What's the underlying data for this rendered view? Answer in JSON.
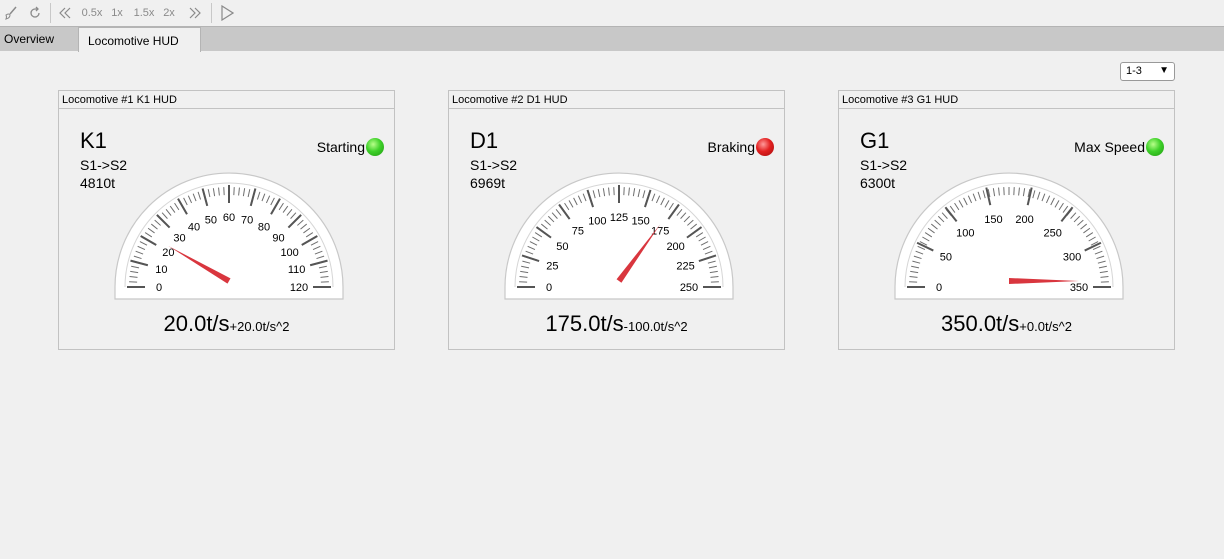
{
  "toolbar": {
    "buttons": [
      {
        "name": "brush-icon"
      },
      {
        "name": "rotate-icon"
      },
      {
        "name": "rewind-icon"
      },
      {
        "label": "0.5x"
      },
      {
        "label": "1x"
      },
      {
        "label": "1.5x"
      },
      {
        "label": "2x"
      },
      {
        "name": "fast-forward-icon"
      },
      {
        "name": "play-icon"
      }
    ],
    "labels": {
      "s05": "0.5x",
      "s1": "1x",
      "s15": "1.5x",
      "s2": "2x"
    }
  },
  "tabs": [
    {
      "label": "Overview",
      "active": false
    },
    {
      "label": "Locomotive HUD",
      "active": true
    }
  ],
  "range_selector": {
    "value": "1-3",
    "caret": "▼"
  },
  "panels": [
    {
      "header": "Locomotive #1 K1 HUD",
      "name": "K1",
      "route": "S1->S2",
      "weight": "4810t",
      "status": "Starting",
      "lamp": "green",
      "speed_text": "20.0t/s",
      "accel_text": "+20.0t/s^2",
      "gauge": {
        "min": 0,
        "max": 120,
        "value": 20,
        "tick_labels": [
          "0",
          "10",
          "20",
          "30",
          "40",
          "50",
          "60",
          "70",
          "80",
          "90",
          "100",
          "110",
          "120"
        ]
      }
    },
    {
      "header": "Locomotive #2 D1 HUD",
      "name": "D1",
      "route": "S1->S2",
      "weight": "6969t",
      "status": "Braking",
      "lamp": "red",
      "speed_text": "175.0t/s",
      "accel_text": "-100.0t/s^2",
      "gauge": {
        "min": 0,
        "max": 250,
        "value": 175,
        "tick_labels": [
          "0",
          "25",
          "50",
          "75",
          "100",
          "125",
          "150",
          "175",
          "200",
          "225",
          "250"
        ]
      }
    },
    {
      "header": "Locomotive #3 G1 HUD",
      "name": "G1",
      "route": "S1->S2",
      "weight": "6300t",
      "status": "Max Speed",
      "lamp": "green",
      "speed_text": "350.0t/s",
      "accel_text": "+0.0t/s^2",
      "gauge": {
        "min": 0,
        "max": 350,
        "value": 350,
        "tick_labels": [
          "0",
          "50",
          "100",
          "150",
          "200",
          "250",
          "300",
          "350"
        ]
      }
    }
  ],
  "colors": {
    "needle": "#d9363e",
    "lamp_green": "#3fd12a",
    "lamp_red": "#e32020",
    "gauge_tick": "#6e6e6e"
  }
}
